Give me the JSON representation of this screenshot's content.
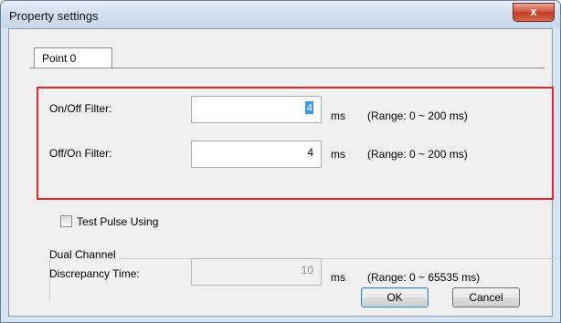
{
  "window": {
    "title": "Property settings",
    "close_symbol": "x"
  },
  "tabs": [
    {
      "label": "Point 0",
      "selected": true
    }
  ],
  "filters": {
    "on_off": {
      "label": "On/Off Filter:",
      "value": "4",
      "unit": "ms",
      "range": "(Range: 0 ~ 200 ms)"
    },
    "off_on": {
      "label": "Off/On Filter:",
      "value": "4",
      "unit": "ms",
      "range": "(Range: 0 ~ 200 ms)"
    }
  },
  "test_pulse": {
    "label": "Test Pulse Using",
    "checked": false
  },
  "dual_channel": {
    "group_label": "Dual Channel",
    "discrepancy": {
      "label": "Discrepancy Time:",
      "value": "10",
      "unit": "ms",
      "range": "(Range: 0 ~ 65535 ms)",
      "enabled": false
    }
  },
  "buttons": {
    "ok": "OK",
    "cancel": "Cancel"
  },
  "colors": {
    "highlight_border": "#e0272a",
    "selection": "#3399ff"
  }
}
